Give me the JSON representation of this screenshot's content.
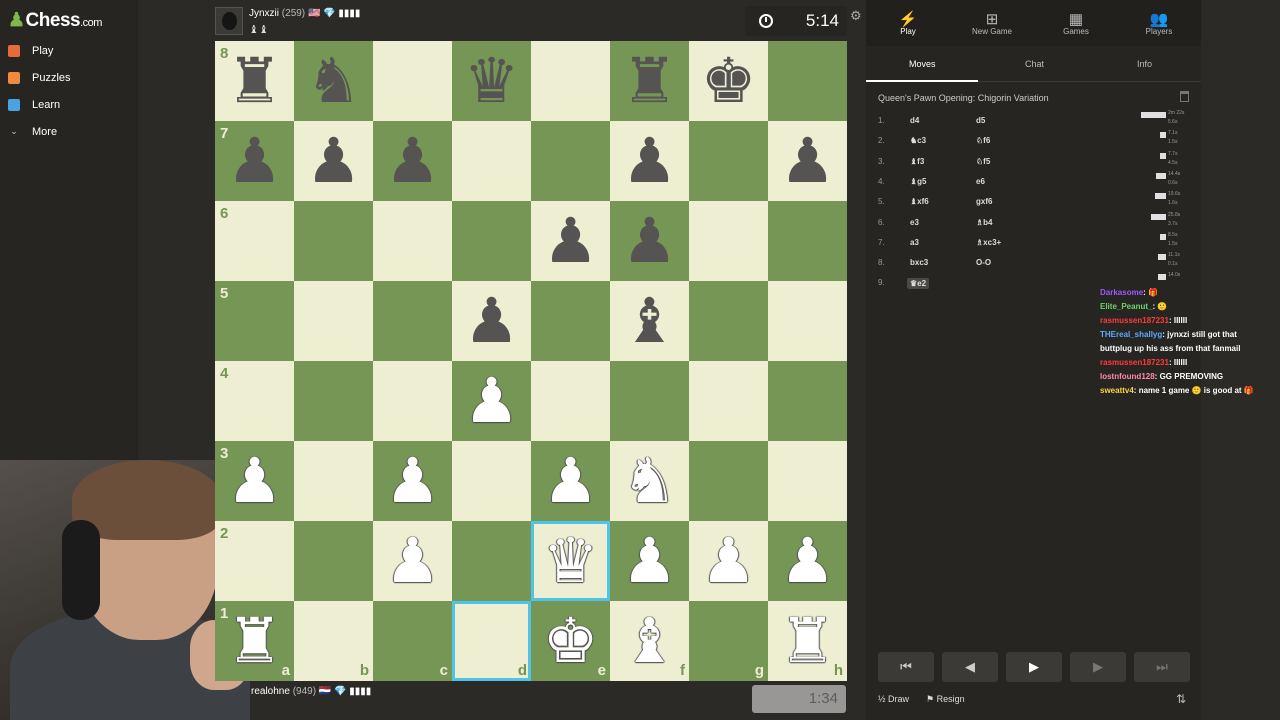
{
  "brand": {
    "logo_text": "Chess",
    "logo_suffix": ".com",
    "pawn_glyph": "♟"
  },
  "sidebar": {
    "items": [
      {
        "label": "Play",
        "icon": "play-icon",
        "color": "#e56b3d"
      },
      {
        "label": "Puzzles",
        "icon": "puzzles-icon",
        "color": "#f08a3c"
      },
      {
        "label": "Learn",
        "icon": "learn-icon",
        "color": "#4aa3df"
      },
      {
        "label": "More",
        "icon": "chevron-down-icon",
        "color": "#cccccc"
      }
    ]
  },
  "top_player": {
    "name": "Jynxzii",
    "rating": "(259)",
    "badges": "🇺🇸 💎 ▮▮▮▮",
    "captured": "♝♝"
  },
  "bottom_player": {
    "name": "realohne",
    "rating": "(949)",
    "badges": "🇳🇱 💎 ▮▮▮▮"
  },
  "timers": {
    "top": "5:14",
    "bottom": "1:34"
  },
  "board": {
    "ranks": [
      "8",
      "7",
      "6",
      "5",
      "4",
      "3",
      "2",
      "1"
    ],
    "files": [
      "a",
      "b",
      "c",
      "d",
      "e",
      "f",
      "g",
      "h"
    ],
    "selected_squares": [
      "e2",
      "d1"
    ],
    "pieces": {
      "a8": "♜",
      "b8": "♞",
      "d8": "♛",
      "f8": "♜",
      "g8": "♚",
      "a7": "♟",
      "b7": "♟",
      "c7": "♟",
      "f7": "♟",
      "h7": "♟",
      "e6": "♟",
      "f6": "♟",
      "d5": "♟",
      "f5": "♝",
      "d4": "♙",
      "a3": "♙",
      "c3": "♙",
      "e3": "♙",
      "f3": "♘",
      "c2": "♙",
      "e2": "♕",
      "f2": "♙",
      "g2": "♙",
      "h2": "♙",
      "a1": "♖",
      "e1": "♔",
      "f1": "♗",
      "h1": "♖"
    }
  },
  "panel": {
    "tabs": [
      {
        "label": "Play",
        "icon": "lightning-icon",
        "glyph": "⚡"
      },
      {
        "label": "New Game",
        "icon": "plus-icon",
        "glyph": "⊞"
      },
      {
        "label": "Games",
        "icon": "board-icon",
        "glyph": "▦"
      },
      {
        "label": "Players",
        "icon": "players-icon",
        "glyph": "👥"
      }
    ],
    "subtabs": [
      "Moves",
      "Chat",
      "Info"
    ],
    "opening": "Queen's Pawn Opening: Chigorin Variation",
    "moves": [
      {
        "n": "1.",
        "w": "d4",
        "b": "d5",
        "tw": "2m 22s",
        "tb": "5.6s",
        "bar": 0.9
      },
      {
        "n": "2.",
        "w": "♞c3",
        "b": "♘f6",
        "tw": "7.1s",
        "tb": "1.5s",
        "bar": 0.2
      },
      {
        "n": "3.",
        "w": "♝f3",
        "b": "♘f5",
        "tw": "7.7s",
        "tb": "4.5s",
        "bar": 0.2
      },
      {
        "n": "4.",
        "w": "♝g5",
        "b": "e6",
        "tw": "14.4s",
        "tb": "0.6s",
        "bar": 0.35
      },
      {
        "n": "5.",
        "w": "♝xf6",
        "b": "gxf6",
        "tw": "19.6s",
        "tb": "1.6s",
        "bar": 0.4
      },
      {
        "n": "6.",
        "w": "e3",
        "b": "♗b4",
        "tw": "25.8s",
        "tb": "3.7s",
        "bar": 0.55
      },
      {
        "n": "7.",
        "w": "a3",
        "b": "♗xc3+",
        "tw": "8.5s",
        "tb": "1.5s",
        "bar": 0.2
      },
      {
        "n": "8.",
        "w": "bxc3",
        "b": "O-O",
        "tw": "11.1s",
        "tb": "0.1s",
        "bar": 0.3
      },
      {
        "n": "9.",
        "w": "♛e2",
        "b": "",
        "tw": "14.0s",
        "tb": "",
        "bar": 0.3
      }
    ]
  },
  "chat": [
    {
      "user": "Darkasome",
      "cls": "u1",
      "msg": "🎁"
    },
    {
      "user": "Elite_Peanut_",
      "cls": "u2",
      "msg": "🙂"
    },
    {
      "user": "rasmussen187231",
      "cls": "u3",
      "msg": "IIIIII"
    },
    {
      "user": "THEreal_shallyg",
      "cls": "u4",
      "msg": "jynxzi still got that buttplug up his ass from that fanmail"
    },
    {
      "user": "rasmussen187231",
      "cls": "u3",
      "msg": "IIIIII"
    },
    {
      "user": "lostnfound128",
      "cls": "u5",
      "msg": "GG PREMOVING"
    },
    {
      "user": "sweattv4",
      "cls": "u6",
      "msg": "name 1 game 🙂 is good at 🎁"
    }
  ],
  "controls": {
    "draw": "Draw",
    "resign": "Resign",
    "draw_glyph": "½",
    "resign_glyph": "⚑",
    "flip_glyph": "⇅"
  },
  "nav": {
    "first": "⏮",
    "prev": "◀",
    "play": "▶",
    "next": "▶",
    "last": "⏭"
  },
  "colors": {
    "light_square": "#eeeed2",
    "dark_square": "#769656",
    "highlight": "#4fc3e8"
  }
}
